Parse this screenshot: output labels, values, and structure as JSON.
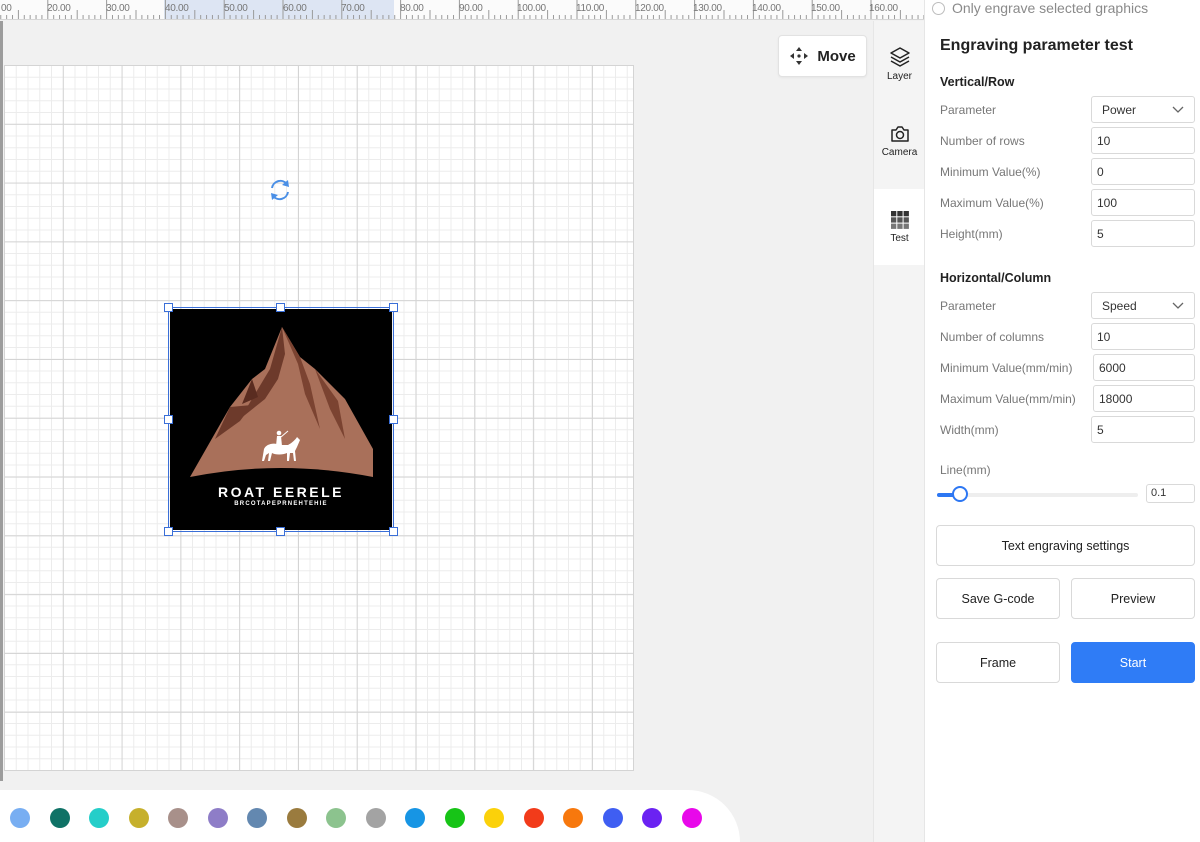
{
  "ruler": {
    "labels": [
      "00",
      "20.00",
      "30.00",
      "40.00",
      "50.00",
      "60.00",
      "70.00",
      "80.00",
      "90.00",
      "100.00",
      "110.00",
      "120.00",
      "130.00",
      "140.00",
      "150.00",
      "160.00"
    ]
  },
  "canvas": {
    "move_label": "Move",
    "logo": {
      "title": "ROAT EERELE",
      "subtitle": "BRCOTAPEPRNEHTEHIE"
    }
  },
  "palette": {
    "colors": [
      "#78aef2",
      "#0f7266",
      "#25cec9",
      "#c6b02c",
      "#a8908a",
      "#8e7dc7",
      "#6388b0",
      "#9a7b3e",
      "#8cc38e",
      "#a3a3a3",
      "#1795e4",
      "#17c417",
      "#fbd10a",
      "#f23b1a",
      "#f7780d",
      "#3f5ef2",
      "#6b22f2",
      "#e808ea"
    ]
  },
  "rail": {
    "layer_label": "Layer",
    "camera_label": "Camera",
    "test_label": "Test"
  },
  "panel": {
    "only_engrave_label": "Only engrave selected graphics",
    "title": "Engraving parameter test",
    "vertical": {
      "heading": "Vertical/Row",
      "parameter_label": "Parameter",
      "parameter_value": "Power",
      "rows_label": "Number of rows",
      "rows_value": "10",
      "min_label": "Minimum Value(%)",
      "min_value": "0",
      "max_label": "Maximum Value(%)",
      "max_value": "100",
      "height_label": "Height(mm)",
      "height_value": "5"
    },
    "horizontal": {
      "heading": "Horizontal/Column",
      "parameter_label": "Parameter",
      "parameter_value": "Speed",
      "cols_label": "Number of columns",
      "cols_value": "10",
      "min_label": "Minimum Value(mm/min)",
      "min_value": "6000",
      "max_label": "Maximum Value(mm/min)",
      "max_value": "18000",
      "width_label": "Width(mm)",
      "width_value": "5"
    },
    "line": {
      "label": "Line(mm)",
      "value": "0.1"
    },
    "buttons": {
      "text_settings": "Text engraving settings",
      "save_gcode": "Save G-code",
      "preview": "Preview",
      "frame": "Frame",
      "start": "Start"
    }
  },
  "colors": {
    "accent": "#2f7cf6",
    "selection": "#3a6fd8",
    "mountain": "#a9705a"
  }
}
